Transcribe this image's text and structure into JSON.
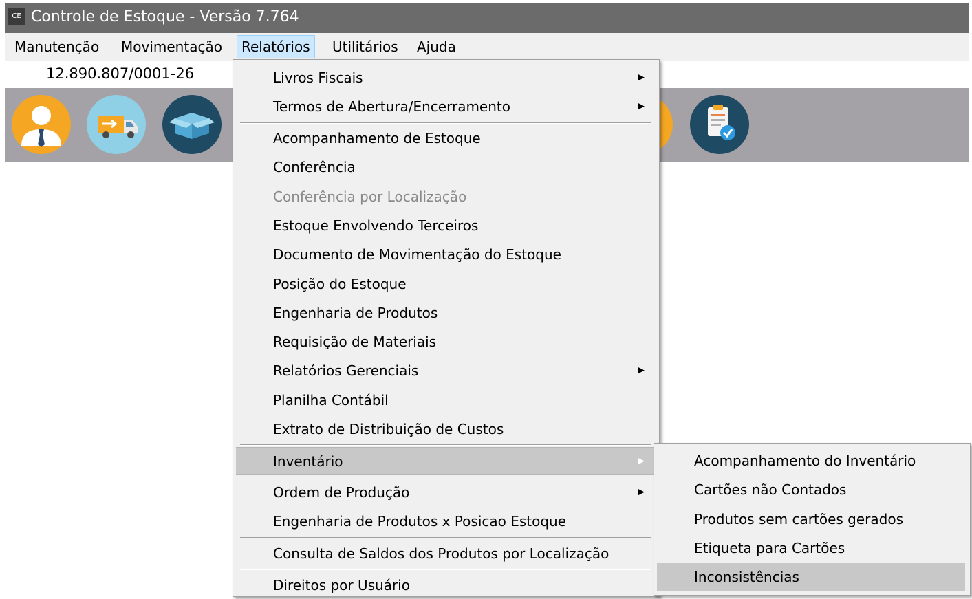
{
  "window": {
    "app_icon_text": "CE",
    "title": "Controle de Estoque - Versão 7.764"
  },
  "menubar": {
    "items": [
      "Manutenção",
      "Movimentação",
      "Relatórios",
      "Utilitários",
      "Ajuda"
    ],
    "open_item": "Relatórios"
  },
  "company": {
    "cnpj": "12.890.807/0001-26"
  },
  "toolbar": {
    "buttons": [
      {
        "icon": "user-icon"
      },
      {
        "icon": "delivery-truck-icon"
      },
      {
        "icon": "box-icon"
      },
      {
        "icon": "clipboard-check-icon"
      }
    ]
  },
  "relatorios_menu": {
    "items": [
      {
        "label": "Livros Fiscais",
        "submenu": true
      },
      {
        "label": "Termos de Abertura/Encerramento",
        "submenu": true
      },
      {
        "label": "Acompanhamento de Estoque"
      },
      {
        "label": "Conferência"
      },
      {
        "label": "Conferência por Localização",
        "disabled": true
      },
      {
        "label": "Estoque Envolvendo Terceiros"
      },
      {
        "label": "Documento de Movimentação do Estoque"
      },
      {
        "label": "Posição do Estoque"
      },
      {
        "label": "Engenharia de Produtos"
      },
      {
        "label": "Requisição de Materiais"
      },
      {
        "label": "Relatórios Gerenciais",
        "submenu": true
      },
      {
        "label": "Planilha Contábil"
      },
      {
        "label": "Extrato de Distribuição de Custos"
      },
      {
        "label": "Inventário",
        "submenu": true,
        "highlighted": true
      },
      {
        "label": "Ordem de Produção",
        "submenu": true
      },
      {
        "label": "Engenharia de Produtos x Posicao Estoque"
      },
      {
        "label": "Consulta de Saldos dos Produtos por Localização"
      },
      {
        "label": "Direitos por Usuário"
      }
    ]
  },
  "inventario_submenu": {
    "items": [
      {
        "label": "Acompanhamento do Inventário"
      },
      {
        "label": "Cartões não Contados"
      },
      {
        "label": "Produtos sem cartões gerados"
      },
      {
        "label": "Etiqueta para Cartões"
      },
      {
        "label": "Inconsistências",
        "highlighted": true
      }
    ]
  },
  "colors": {
    "titlebar": "#6b6b6b",
    "toolbar": "#a4a2a6",
    "menu_bg": "#f0f0f0",
    "highlight": "#c8c8c8",
    "menubar_open": "#cce8ff"
  }
}
